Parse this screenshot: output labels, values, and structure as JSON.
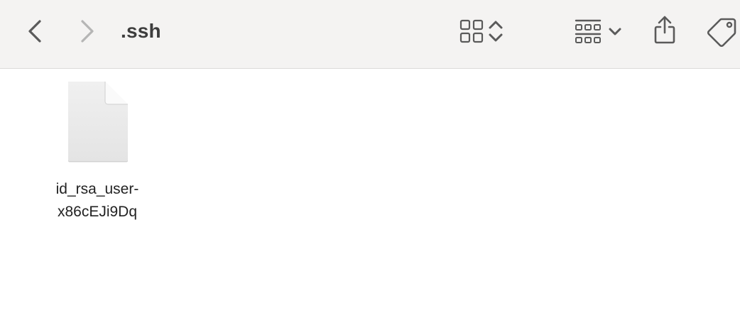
{
  "window": {
    "folder_title": ".ssh"
  },
  "toolbar": {
    "back_icon": "chevron-left-icon",
    "forward_icon": "chevron-right-icon",
    "view_mode_icon": "icon-grid-view-icon",
    "view_mode_toggle_icon": "chevron-up-down-icon",
    "group_icon": "group-by-icon",
    "group_dropdown_icon": "chevron-down-icon",
    "share_icon": "share-icon",
    "tag_icon": "tag-icon"
  },
  "files": [
    {
      "icon": "generic-document-icon",
      "name_line1": "id_rsa_user-",
      "name_line2": "x86cEJi9Dq"
    }
  ],
  "colors": {
    "toolbar_bg": "#f4f3f2",
    "icon_active": "#5a5a5a",
    "icon_disabled": "#b5b5b5",
    "content_bg": "#ffffff"
  }
}
